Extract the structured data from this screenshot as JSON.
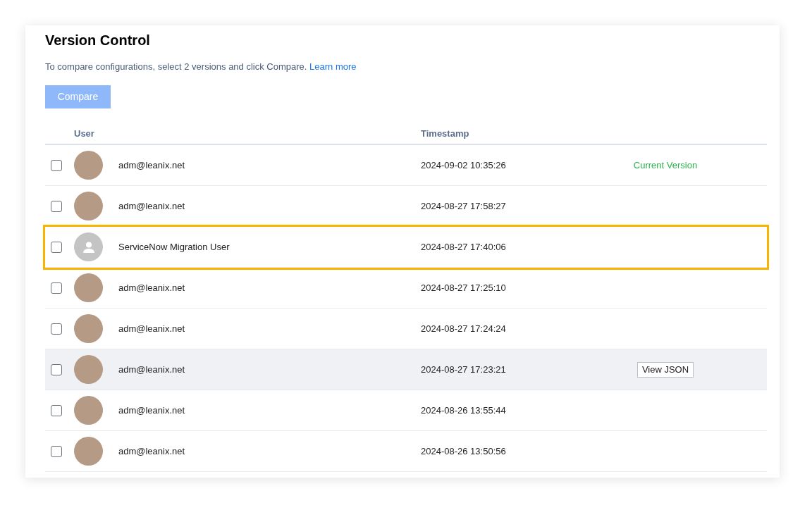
{
  "title": "Version Control",
  "description": {
    "text": "To compare configurations, select 2 versions and click Compare.",
    "link": "Learn more"
  },
  "compare_button": {
    "label": "Compare",
    "disabled": true
  },
  "table": {
    "columns": [
      "User",
      "Timestamp"
    ],
    "rows": [
      {
        "checked": false,
        "kind": "photo_avatar",
        "user": "adm@leanix.net",
        "timestamp": "2024-09-02 10:35:26",
        "highlighted": false,
        "hovered": false,
        "status": "Current Version"
      },
      {
        "checked": false,
        "kind": "photo_avatar",
        "user": "adm@leanix.net",
        "timestamp": "2024-08-27 17:58:27",
        "highlighted": false,
        "hovered": false
      },
      {
        "checked": false,
        "kind": "default_avatar",
        "user": "ServiceNow Migration User",
        "timestamp": "2024-08-27 17:40:06",
        "highlighted": true,
        "hovered": false
      },
      {
        "checked": false,
        "kind": "photo_avatar",
        "user": "adm@leanix.net",
        "timestamp": "2024-08-27 17:25:10",
        "highlighted": false,
        "hovered": false
      },
      {
        "checked": false,
        "kind": "photo_avatar",
        "user": "adm@leanix.net",
        "timestamp": "2024-08-27 17:24:24",
        "highlighted": false,
        "hovered": false
      },
      {
        "checked": false,
        "kind": "photo_avatar",
        "user": "adm@leanix.net",
        "timestamp": "2024-08-27 17:23:21",
        "highlighted": false,
        "hovered": true,
        "action": "View JSON"
      },
      {
        "checked": false,
        "kind": "photo_avatar",
        "user": "adm@leanix.net",
        "timestamp": "2024-08-26 13:55:44",
        "highlighted": false,
        "hovered": false
      },
      {
        "checked": false,
        "kind": "photo_avatar",
        "user": "adm@leanix.net",
        "timestamp": "2024-08-26 13:50:56",
        "highlighted": false,
        "hovered": false
      }
    ]
  }
}
